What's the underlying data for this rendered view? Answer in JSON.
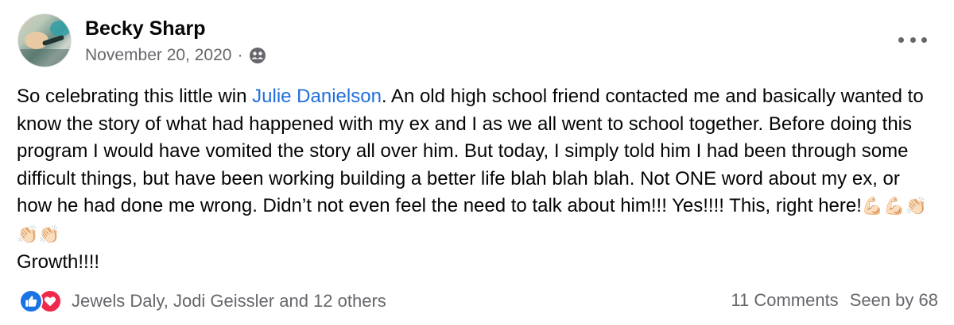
{
  "post": {
    "author": "Becky Sharp",
    "date": "November 20, 2020",
    "separator": "·",
    "privacy_icon": "friends-icon",
    "text": {
      "intro": "So celebrating this little win ",
      "mention": "Julie Danielson",
      "body": ". An old high school friend contacted me and basically wanted to know the story of what had happened with my ex and I as we all went to school together. Before doing this program I would have vomited the story all over him. But today, I simply told him I had been through some difficult things, but have been working building a better life blah blah blah. Not ONE word about my ex, or how he had done me wrong. Didn’t not even feel the need to talk about him!!!  Yes!!!! This, right here!",
      "emojis": "💪🏻💪🏻👏🏻👏🏻👏🏻",
      "closing": "Growth!!!!"
    }
  },
  "reactions": {
    "icons": [
      "like-icon",
      "love-icon"
    ],
    "names": "Jewels Daly, Jodi Geissler and 12 others"
  },
  "stats": {
    "comments": "11 Comments",
    "seen": "Seen by 68"
  },
  "colors": {
    "link": "#216fdb",
    "secondary_text": "#65676b",
    "like_blue": "#1b74e4",
    "love_red": "#f02849"
  }
}
